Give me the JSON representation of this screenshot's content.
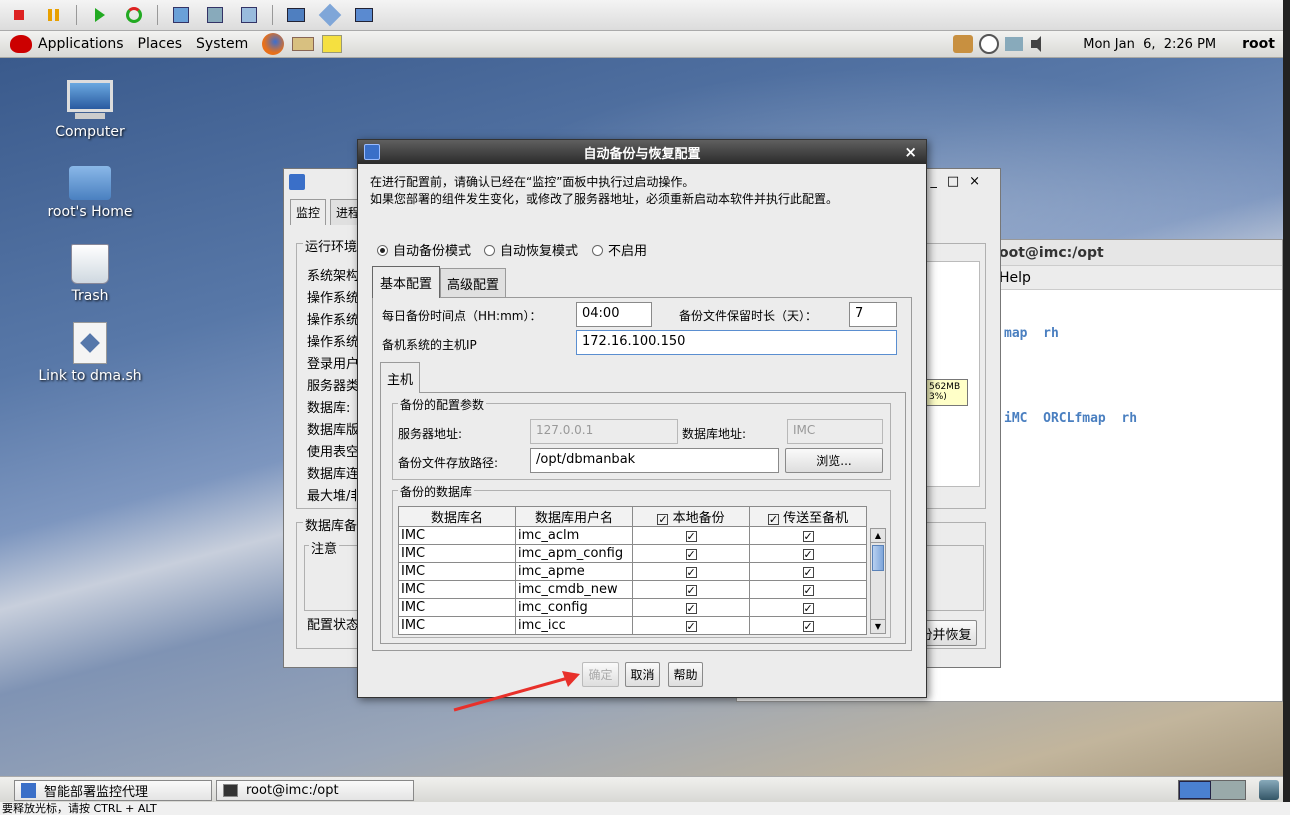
{
  "top_panel": {
    "menus": [
      "Applications",
      "Places",
      "System"
    ],
    "clock": "Mon Jan  6,  2:26 PM",
    "user": "root"
  },
  "desktop": {
    "icons": [
      "Computer",
      "root's Home",
      "Trash",
      "Link to dma.sh"
    ]
  },
  "back_window": {
    "tabs": [
      "监控",
      "进程"
    ],
    "section_runtime": "运行环境",
    "rows": [
      "系统架构",
      "操作系统",
      "操作系统",
      "操作系统",
      "登录用户",
      "服务器类",
      "数据库:",
      "数据库版",
      "使用表空",
      "数据库连",
      "最大堆/非"
    ],
    "section_db_backup": "数据库备",
    "notice": "注意",
    "config_status": "配置状态",
    "memory_badge": "562MB 3%)",
    "restore_button": "份并恢复"
  },
  "terminal": {
    "title": "oot@imc:/opt",
    "menu": "Help",
    "line1": "map  rh",
    "line2": "iMC  ORCLfmap  rh"
  },
  "dialog": {
    "title": "自动备份与恢复配置",
    "close": "×",
    "info_line1": "在进行配置前，请确认已经在“监控”面板中执行过启动操作。",
    "info_line2": "如果您部署的组件发生变化，或修改了服务器地址，必须重新启动本软件并执行此配置。",
    "modes": [
      "自动备份模式",
      "自动恢复模式",
      "不启用"
    ],
    "tabs": [
      "基本配置",
      "高级配置"
    ],
    "daily_time_label": "每日备份时间点（HH:mm）：",
    "daily_time_value": "04:00",
    "retain_label": "备份文件保留时长（天）：",
    "retain_value": "7",
    "standby_ip_label": "备机系统的主机IP",
    "standby_ip_value": "172.16.100.150",
    "host_tab": "主机",
    "params_group": "备份的配置参数",
    "server_addr_label": "服务器地址:",
    "server_addr_value": "127.0.0.1",
    "db_addr_label": "数据库地址:",
    "db_addr_value": "IMC",
    "path_label": "备份文件存放路径:",
    "path_value": "/opt/dbmanbak",
    "browse": "浏览...",
    "db_group": "备份的数据库",
    "columns": [
      "数据库名",
      "数据库用户名",
      "本地备份",
      "传送至备机"
    ],
    "rows": [
      [
        "IMC",
        "imc_aclm"
      ],
      [
        "IMC",
        "imc_apm_config"
      ],
      [
        "IMC",
        "imc_apme"
      ],
      [
        "IMC",
        "imc_cmdb_new"
      ],
      [
        "IMC",
        "imc_config"
      ],
      [
        "IMC",
        "imc_icc"
      ]
    ],
    "ok": "确定",
    "cancel": "取消",
    "help": "帮助"
  },
  "taskbar": {
    "tasks": [
      "智能部署监控代理",
      "root@imc:/opt"
    ]
  },
  "status_line": "要释放光标，请按 CTRL + ALT"
}
